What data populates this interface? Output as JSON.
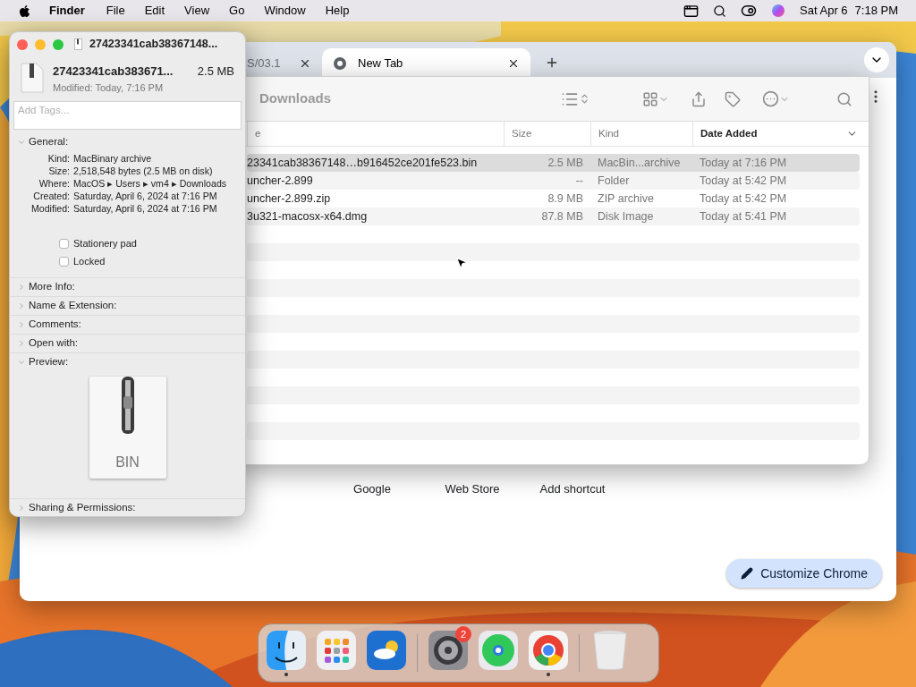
{
  "menu_bar": {
    "app_name": "Finder",
    "menus": [
      "File",
      "Edit",
      "View",
      "Go",
      "Window",
      "Help"
    ],
    "date": "Sat Apr 6",
    "time": "7:18 PM"
  },
  "browser": {
    "tabs": [
      {
        "label": "S/03.1",
        "selected": false
      },
      {
        "label": "New Tab",
        "selected": true
      }
    ],
    "shortcuts": [
      "Google",
      "Web Store",
      "Add shortcut"
    ],
    "customize_button": "Customize Chrome"
  },
  "finder": {
    "title": "Downloads",
    "columns": [
      {
        "label": "e",
        "sorted": false
      },
      {
        "label": "Size",
        "sorted": false
      },
      {
        "label": "Kind",
        "sorted": false
      },
      {
        "label": "Date Added",
        "sorted": true
      }
    ],
    "rows": [
      {
        "name": "23341cab38367148…b916452ce201fe523.bin",
        "size": "2.5 MB",
        "kind": "MacBin...archive",
        "date": "Today at 7:16 PM",
        "selected": true
      },
      {
        "name": "uncher-2.899",
        "size": "--",
        "kind": "Folder",
        "date": "Today at 5:42 PM",
        "selected": false
      },
      {
        "name": "uncher-2.899.zip",
        "size": "8.9 MB",
        "kind": "ZIP archive",
        "date": "Today at 5:42 PM",
        "selected": false
      },
      {
        "name": "3u321-macosx-x64.dmg",
        "size": "87.8 MB",
        "kind": "Disk Image",
        "date": "Today at 5:41 PM",
        "selected": false
      }
    ]
  },
  "info_window": {
    "title": "27423341cab38367148...",
    "name": "27423341cab383671...",
    "size": "2.5 MB",
    "modified": "Modified: Today, 7:16 PM",
    "tags_placeholder": "Add Tags...",
    "sections": [
      {
        "kind": "general",
        "label": "General:",
        "expanded": true,
        "fields": [
          {
            "label": "Kind:",
            "value": "MacBinary archive"
          },
          {
            "label": "Size:",
            "value": "2,518,548 bytes (2.5 MB on disk)"
          },
          {
            "label": "Where:",
            "value": "MacOS ▸ Users ▸ vm4 ▸ Downloads"
          },
          {
            "label": "Created:",
            "value": "Saturday, April 6, 2024 at 7:16 PM"
          },
          {
            "label": "Modified:",
            "value": "Saturday, April 6, 2024 at 7:16 PM"
          }
        ],
        "checkboxes": [
          {
            "label": "Stationery pad",
            "checked": false
          },
          {
            "label": "Locked",
            "checked": false
          }
        ]
      },
      {
        "label": "More Info:",
        "expanded": false
      },
      {
        "label": "Name & Extension:",
        "expanded": false
      },
      {
        "label": "Comments:",
        "expanded": false
      },
      {
        "label": "Open with:",
        "expanded": false
      },
      {
        "kind": "preview",
        "label": "Preview:",
        "expanded": true,
        "file_type": "BIN"
      },
      {
        "label": "Sharing & Permissions:",
        "expanded": false
      }
    ]
  },
  "dock": {
    "items": [
      {
        "kind": "finder",
        "running": true
      },
      {
        "kind": "launchpad",
        "running": false
      },
      {
        "kind": "weather",
        "running": false
      },
      {
        "kind": "separator"
      },
      {
        "kind": "settings",
        "running": false,
        "badge": "2"
      },
      {
        "kind": "findmy",
        "running": false
      },
      {
        "kind": "chrome",
        "running": true
      },
      {
        "kind": "separator"
      },
      {
        "kind": "trash",
        "running": false
      }
    ]
  }
}
